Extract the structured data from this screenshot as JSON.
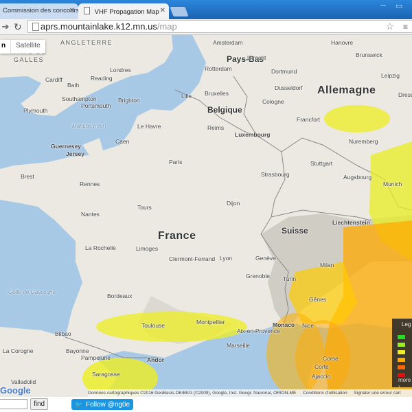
{
  "browser": {
    "tabs": [
      {
        "title": "Commission des concours - F",
        "active": false
      },
      {
        "title": "VHF Propagation Map",
        "active": true
      }
    ],
    "url_host": "aprs.mountainlake.k12.mn.us",
    "url_path": "/map"
  },
  "map": {
    "type_controls": {
      "map": "n",
      "satellite": "Satellite"
    },
    "countries": {
      "france": "France",
      "allemagne": "Allemagne",
      "pays_bas": "Pays-Bas",
      "belgique": "Belgique",
      "luxembourg": "Luxembourg",
      "suisse": "Suisse",
      "liechtenstein": "Liechtenstein",
      "monaco": "Monaco",
      "andorra": "Andor",
      "angleterre": "ANGLETERRE",
      "pays_de_galles_1": "PAYS DE",
      "pays_de_galles_2": "GALLES"
    },
    "seas": {
      "manche": "Manche (mer)",
      "gascogne": "Golfe de Gascogne"
    },
    "cities": [
      "Londres",
      "Cardiff",
      "Bath",
      "Reading",
      "Plymouth",
      "Amsterdam",
      "Utrecht",
      "Rotterdam",
      "Dortmund",
      "Bruxelles",
      "Düsseldorf",
      "Cologne",
      "Francfort",
      "Nuremberg",
      "Stuttgart",
      "Augsbourg",
      "Munich",
      "Strasbourg",
      "Guernesey",
      "Jersey",
      "Brest",
      "Rennes",
      "Caen",
      "Paris",
      "Reims",
      "Nantes",
      "Tours",
      "Dijon",
      "Genève",
      "La Rochelle",
      "Limoges",
      "Clermont-Ferrand",
      "Lyon",
      "Grenoble",
      "Bordeaux",
      "Toulouse",
      "Montpellier",
      "Marseille",
      "Nice",
      "Aix-en-Provence",
      "Bilbao",
      "Pampelune",
      "Saragosse",
      "Valladolid",
      "Hanovre",
      "Brunswick",
      "Leipzig",
      "Dresde",
      "Portsmouth",
      "Southampton",
      "Brighton",
      "Le Havre",
      "Lille",
      "Gênes",
      "Corse",
      "Corte",
      "Ajaccio",
      "Turin",
      "Milan",
      "La Corogne",
      "Bayonne"
    ],
    "legend": {
      "title": "Leg",
      "more": "more ›",
      "colors": [
        "#22dd22",
        "#99ee22",
        "#eeee22",
        "#ffaa00",
        "#ff6600",
        "#dd1111"
      ]
    },
    "google": "Google",
    "attribution": [
      "Données cartographiques ©2016 GeoBasis-DE/BKG (©2009), Google, Inst. Geogr. Nacional, ORION-ME",
      "Conditions d'utilisation",
      "Signaler une erreur cart"
    ]
  },
  "bottom": {
    "find_button": "find",
    "follow_label": "Follow @ng0e"
  }
}
